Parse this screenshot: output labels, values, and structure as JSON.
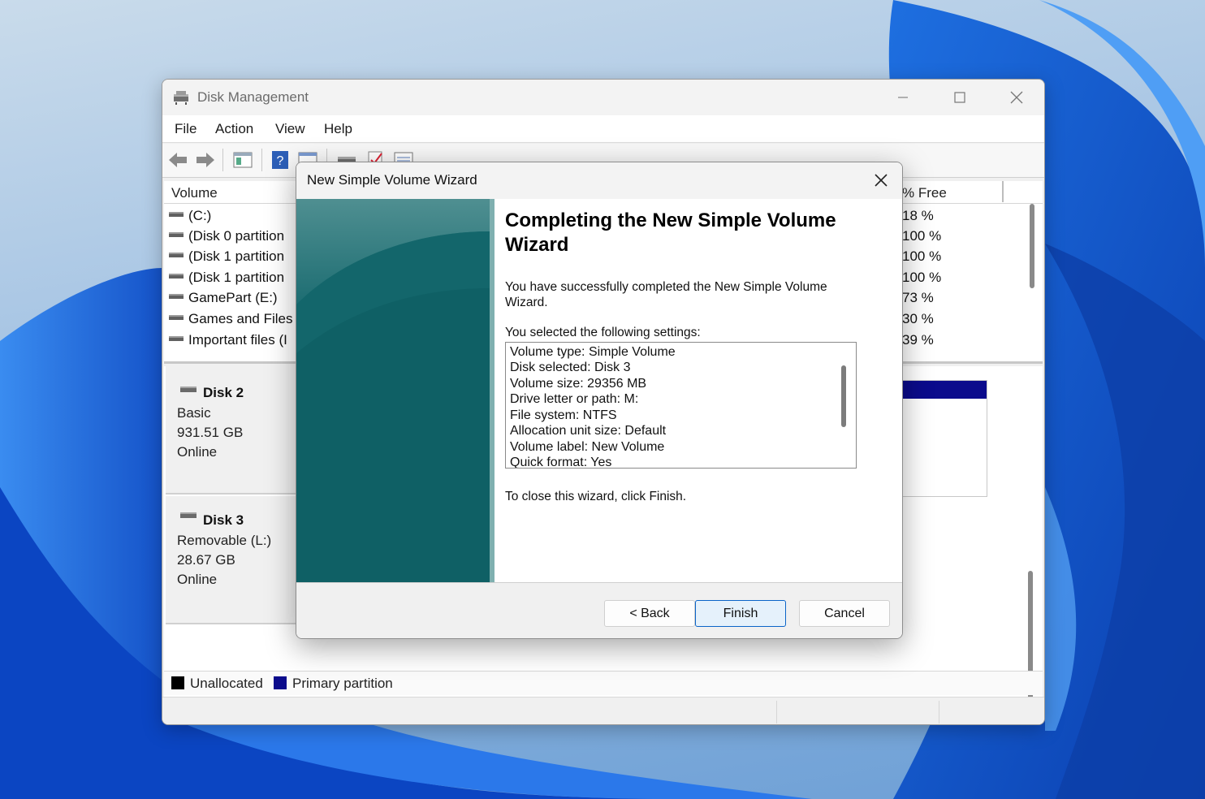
{
  "window": {
    "title": "Disk Management",
    "menu": [
      "File",
      "Action",
      "View",
      "Help"
    ]
  },
  "volume_list": {
    "columns": {
      "volume": "Volume",
      "free": "% Free"
    },
    "rows": [
      {
        "name": "(C:)",
        "free": "18 %"
      },
      {
        "name": "(Disk 0 partition",
        "free": "100 %"
      },
      {
        "name": "(Disk 1 partition",
        "free": "100 %"
      },
      {
        "name": "(Disk 1 partition",
        "free": "100 %"
      },
      {
        "name": "GamePart (E:)",
        "free": "73 %"
      },
      {
        "name": "Games and Files",
        "free": "30 %"
      },
      {
        "name": "Important files (I",
        "free": "39 %"
      }
    ]
  },
  "disks": [
    {
      "name": "Disk 2",
      "type": "Basic",
      "size": "931.51 GB",
      "status": "Online"
    },
    {
      "name": "Disk 3",
      "type": "Removable (L:)",
      "size": "28.67 GB",
      "status": "Online"
    }
  ],
  "legend": [
    {
      "label": "Unallocated",
      "color": "#000000"
    },
    {
      "label": "Primary partition",
      "color": "#0b0b8c"
    }
  ],
  "wizard": {
    "title": "New Simple Volume Wizard",
    "heading": "Completing the New Simple Volume Wizard",
    "success_text": "You have successfully completed the New Simple Volume Wizard.",
    "settings_label": "You selected the following settings:",
    "settings": [
      "Volume type: Simple Volume",
      "Disk selected: Disk 3",
      "Volume size: 29356 MB",
      "Drive letter or path: M:",
      "File system: NTFS",
      "Allocation unit size: Default",
      "Volume label: New Volume",
      "Quick format: Yes"
    ],
    "close_hint": "To close this wizard, click Finish.",
    "buttons": {
      "back": "< Back",
      "finish": "Finish",
      "cancel": "Cancel"
    }
  },
  "colors": {
    "accent": "#0a64c8",
    "banner": "#0f5e63"
  }
}
